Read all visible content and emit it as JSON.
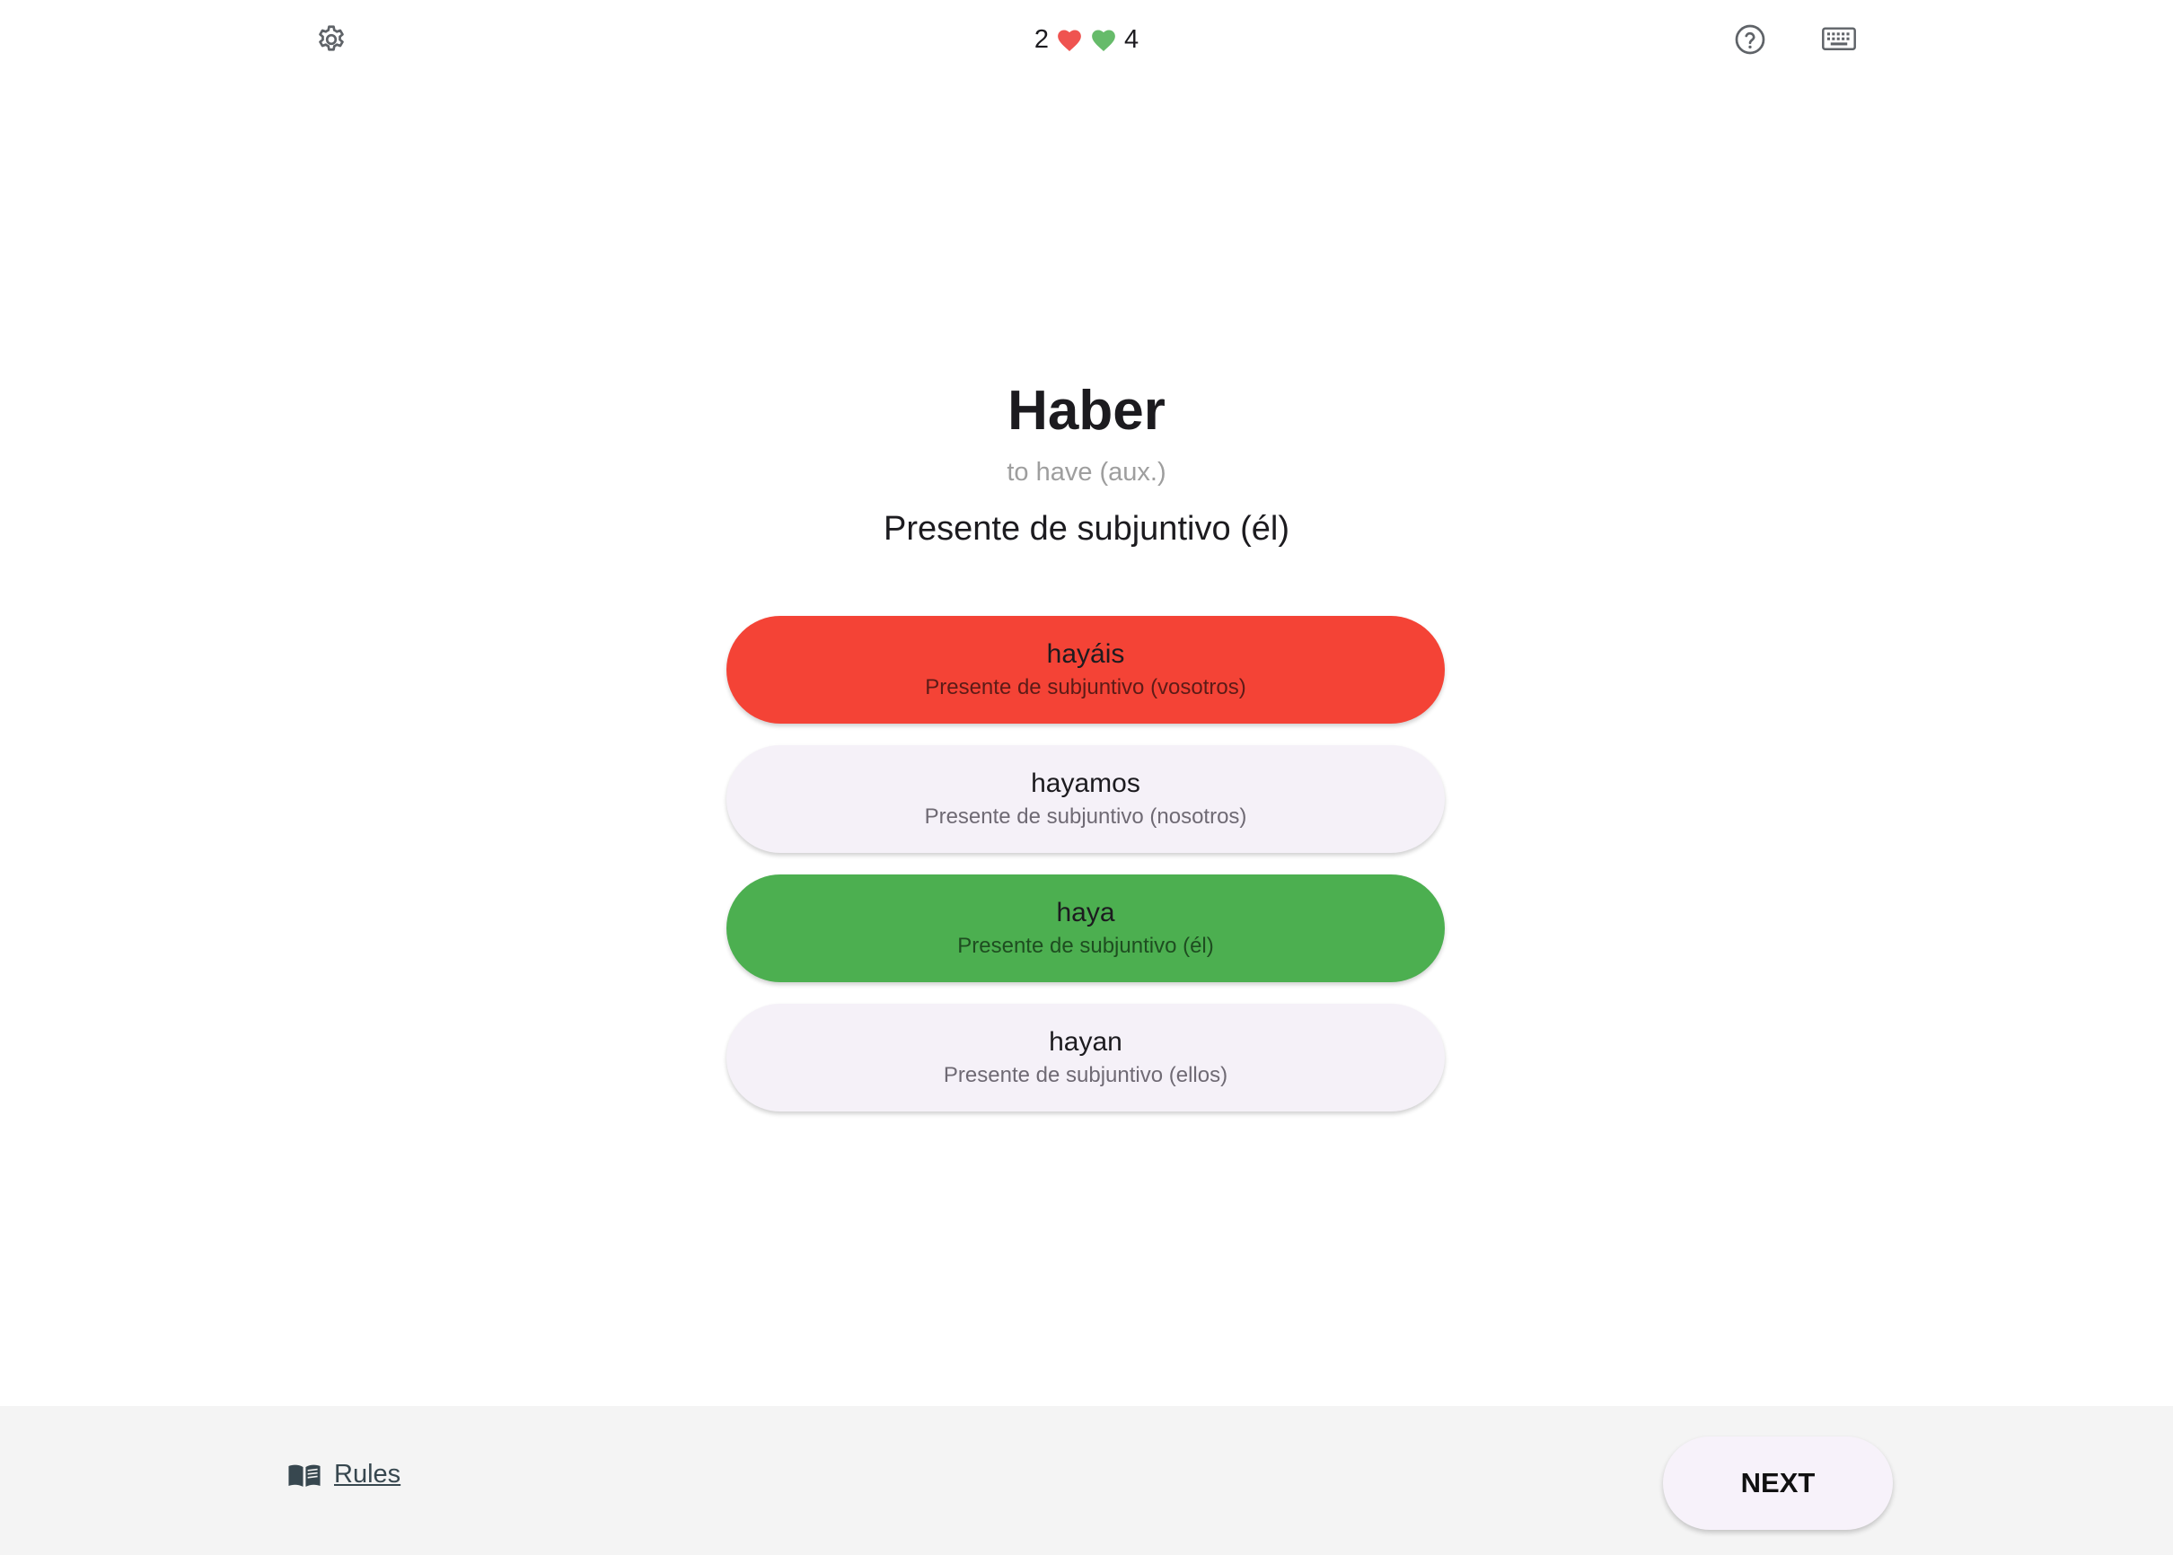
{
  "topbar": {
    "settings_icon": "gear-icon",
    "help_icon": "help-circle-icon",
    "keyboard_icon": "keyboard-icon",
    "wrong_count": "2",
    "correct_count": "4",
    "wrong_color": "#f44336",
    "correct_color": "#4caf50"
  },
  "question": {
    "verb": "Haber",
    "translation": "to have (aux.)",
    "prompt": "Presente de subjuntivo (él)"
  },
  "options": [
    {
      "form": "hayáis",
      "tense": "Presente de subjuntivo (vosotros)",
      "state": "wrong"
    },
    {
      "form": "hayamos",
      "tense": "Presente de subjuntivo (nosotros)",
      "state": "neutral"
    },
    {
      "form": "haya",
      "tense": "Presente de subjuntivo (él)",
      "state": "correct"
    },
    {
      "form": "hayan",
      "tense": "Presente de subjuntivo (ellos)",
      "state": "neutral"
    }
  ],
  "footer": {
    "rules_label": "Rules",
    "rules_icon": "book-icon",
    "next_label": "NEXT"
  }
}
